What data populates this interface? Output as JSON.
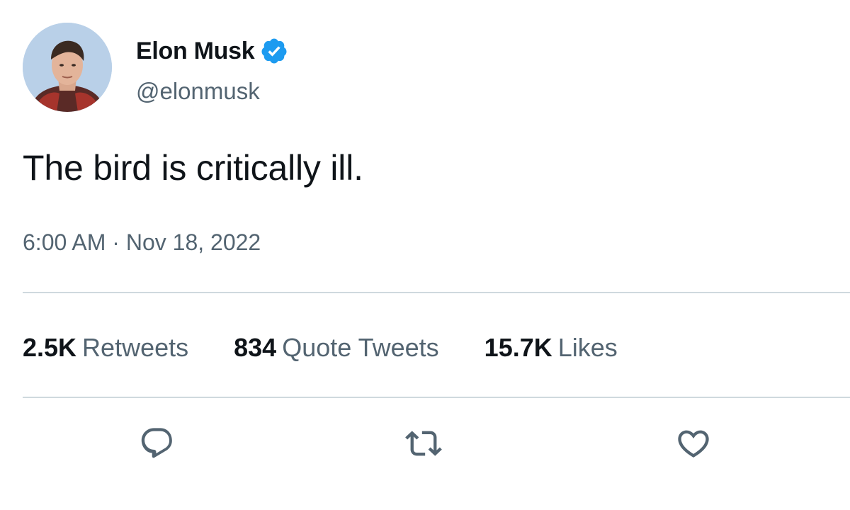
{
  "author": {
    "name": "Elon Musk",
    "handle": "@elonmusk",
    "verified_icon": "verified-badge-icon",
    "avatar_icon": "profile-photo"
  },
  "tweet": {
    "text": "The bird is critically ill.",
    "timestamp": "6:00 AM · Nov 18, 2022"
  },
  "stats": [
    {
      "count": "2.5K",
      "label": "Retweets"
    },
    {
      "count": "834",
      "label": "Quote Tweets"
    },
    {
      "count": "15.7K",
      "label": "Likes"
    }
  ],
  "actions": [
    {
      "icon": "reply-icon"
    },
    {
      "icon": "retweet-icon"
    },
    {
      "icon": "like-icon"
    }
  ],
  "colors": {
    "primary_text": "#0f1419",
    "secondary_text": "#536471",
    "divider": "#cfd9de",
    "verified": "#1d9bf0"
  }
}
